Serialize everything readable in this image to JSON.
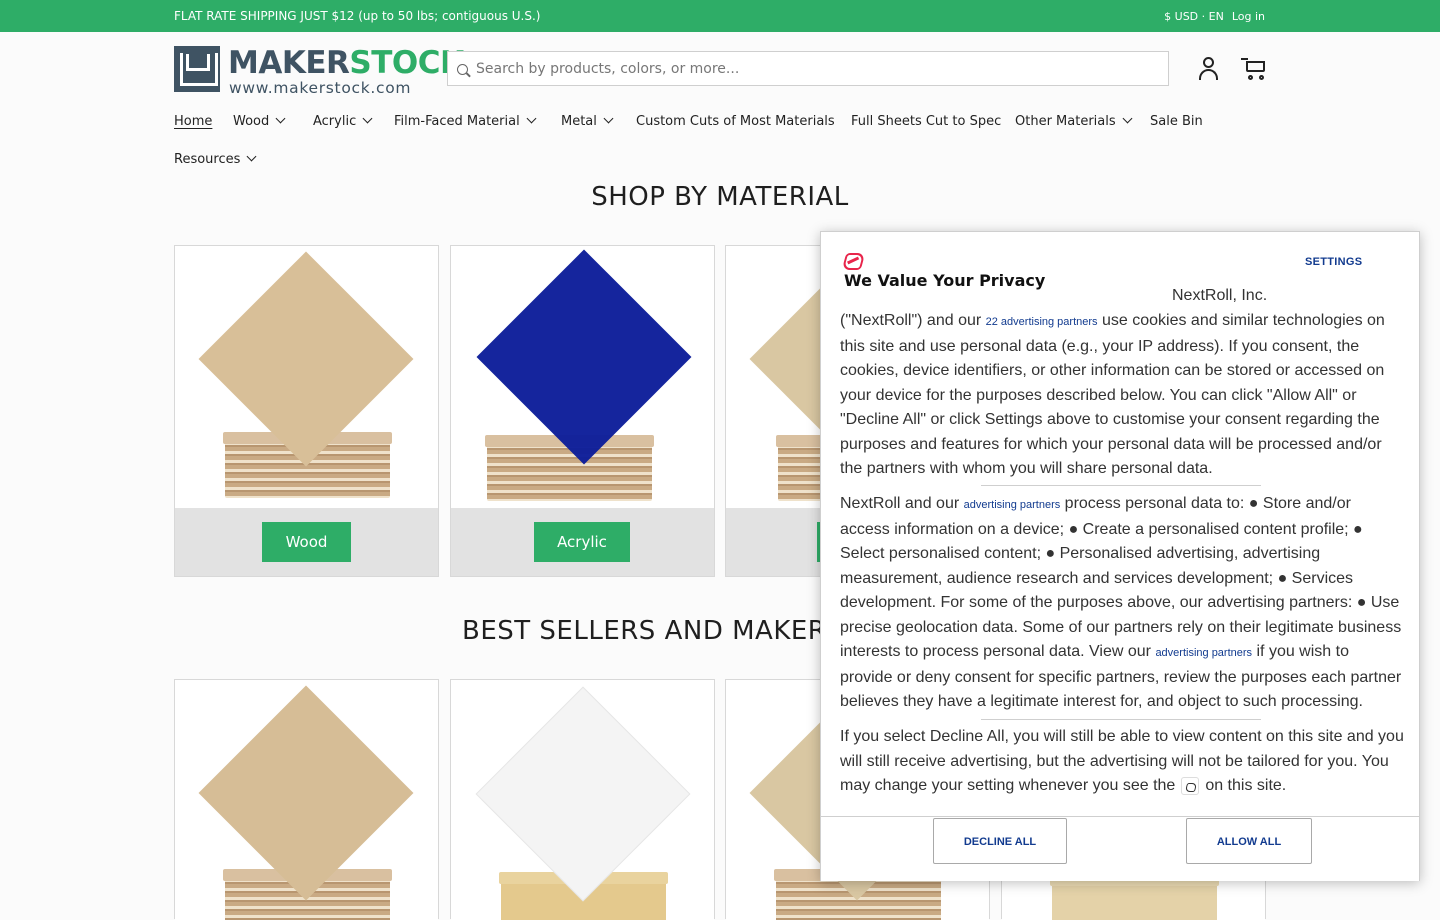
{
  "announcement": {
    "message": "FLAT RATE SHIPPING JUST $12 (up to 50 lbs; contiguous U.S.)",
    "currency": "$ USD · EN",
    "login": "Log in"
  },
  "header": {
    "brand_maker": "MAKER",
    "brand_stock": "STOCK",
    "brand_url": "www.makerstock.com",
    "search_placeholder": "Search by products, colors, or more...",
    "icons": [
      "search-icon",
      "account-icon",
      "cart-icon"
    ]
  },
  "nav": {
    "items": [
      {
        "label": "Home",
        "dropdown": false
      },
      {
        "label": "Wood",
        "dropdown": true
      },
      {
        "label": "Acrylic",
        "dropdown": true
      },
      {
        "label": "Film-Faced Material",
        "dropdown": true
      },
      {
        "label": "Metal",
        "dropdown": true
      },
      {
        "label": "Custom Cuts of Most Materials",
        "dropdown": false
      },
      {
        "label": "Full Sheets Cut to Spec",
        "dropdown": false
      },
      {
        "label": "Other Materials",
        "dropdown": true
      },
      {
        "label": "Sale Bin",
        "dropdown": false
      },
      {
        "label": "Resources",
        "dropdown": true
      }
    ]
  },
  "shop_by_material": {
    "title": "SHOP BY MATERIAL",
    "cards": [
      {
        "label": "Wood"
      },
      {
        "label": "Acrylic"
      }
    ]
  },
  "best_sellers": {
    "title": "BEST SELLERS AND MAKER"
  },
  "privacy": {
    "title": "We Value Your Privacy",
    "settings": "SETTINGS",
    "company": "NextRoll, Inc.",
    "p1_a": "(\"NextRoll\") and our ",
    "p1_link": "22 advertising partners",
    "p1_b": " use cookies and similar technologies on this site and use personal data (e.g., your IP address). If you consent, the cookies, device identifiers, or other information can be stored or accessed on your device for the purposes described below. You can click \"Allow All\" or \"Decline All\" or click Settings above to customise your consent regarding the purposes and features for which your personal data will be processed and/or the partners with whom you will share personal data.",
    "p2_a": "NextRoll and our ",
    "p2_link1": "advertising partners",
    "p2_b": " process personal data to: ● Store and/or access information on a device; ● Create a personalised content profile; ● Select personalised content; ● Personalised advertising, advertising measurement, audience research and services development; ● Services development. For some of the purposes above, our advertising partners: ● Use precise geolocation data. Some of our partners rely on their legitimate business interests to process personal data. View our ",
    "p2_link2": "advertising partners",
    "p2_c": " if you wish to provide or deny consent for specific partners, review the purposes each partner believes they have a legitimate interest for, and object to such processing.",
    "p3_a": "If you select Decline All, you will still be able to view content on this site and you will still receive advertising, but the advertising will not be tailored for you. You may change your setting whenever you see the",
    "p3_b": "on this site.",
    "decline": "DECLINE ALL",
    "allow": "ALLOW ALL"
  },
  "colors": {
    "brand_green": "#2ead67",
    "brand_slate": "#3f5363",
    "consent_link": "#123b8f",
    "nextroll_red": "#e8254b"
  }
}
